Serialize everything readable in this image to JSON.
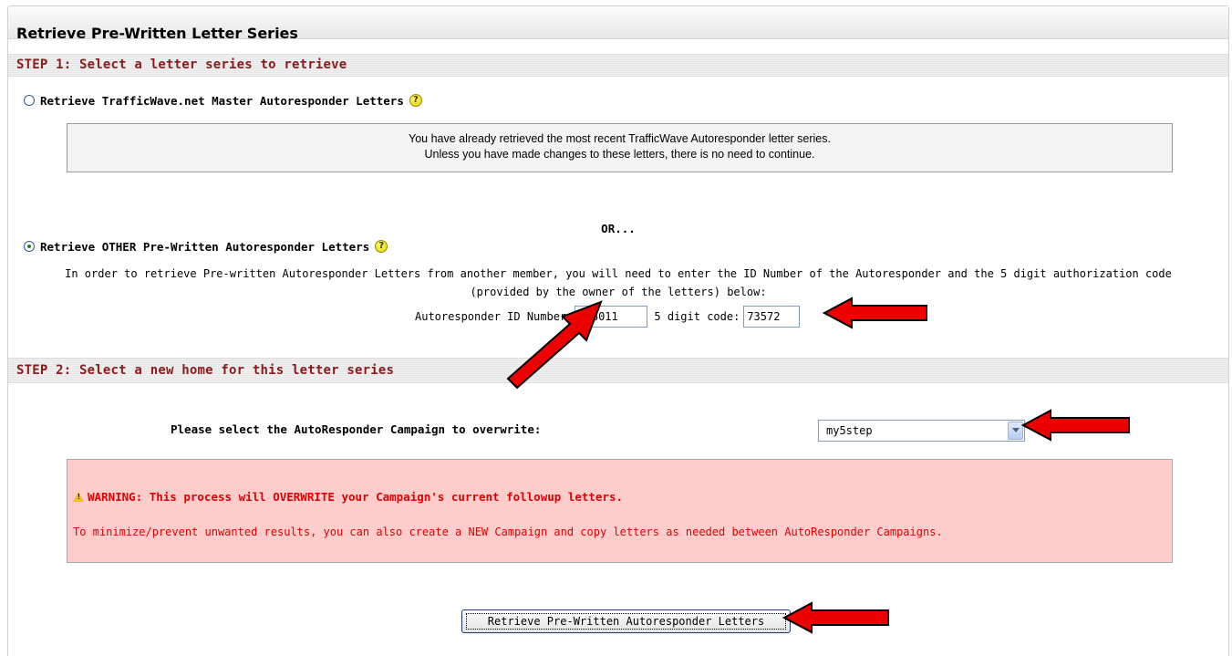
{
  "panel": {
    "title": "Retrieve Pre-Written Letter Series"
  },
  "step1": {
    "heading": "STEP 1: Select a letter series to retrieve",
    "option_master": {
      "label": "Retrieve TrafficWave.net Master Autoresponder Letters",
      "selected": false
    },
    "info": {
      "line1": "You have already retrieved the most recent TrafficWave Autoresponder letter series.",
      "line2": "Unless you have made changes to these letters, there is no need to continue."
    },
    "or_text": "OR...",
    "option_other": {
      "label": "Retrieve OTHER Pre-Written Autoresponder Letters",
      "selected": true
    },
    "description": {
      "line1": "In order to retrieve Pre-written Autoresponder Letters from another member, you will need to enter the ID Number of the Autoresponder and the 5 digit authorization code",
      "line2": "(provided by the owner of the letters) below:"
    },
    "id_label": "Autoresponder ID Number:",
    "id_value": "138011",
    "code_label": "5 digit code:",
    "code_value": "73572"
  },
  "step2": {
    "heading": "STEP 2: Select a new home for this letter series",
    "select_label": "Please select the AutoResponder Campaign to overwrite:",
    "select_value": "my5step"
  },
  "warning": {
    "title": "WARNING: This process will OVERWRITE your Campaign's current followup letters.",
    "body": "To minimize/prevent unwanted results, you can also create a NEW Campaign and copy letters as needed between AutoResponder Campaigns."
  },
  "submit_label": "Retrieve Pre-Written Autoresponder Letters",
  "icons": {
    "help": "help-icon",
    "warning": "warning-triangle-icon",
    "dropdown": "chevron-down-icon",
    "annotation": "red-arrow-icon"
  },
  "colors": {
    "step_heading": "#8b1a1a",
    "warning_bg": "#ffcccc",
    "warning_text": "#e00000",
    "annotation_arrow": "#ee0000"
  }
}
